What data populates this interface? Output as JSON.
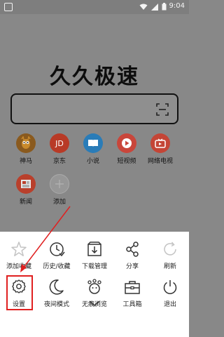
{
  "status_bar": {
    "time": "9:04"
  },
  "home": {
    "title": "久久极速",
    "shortcuts": [
      {
        "label": "神马",
        "icon": "shenma-icon",
        "color": "#a5671f"
      },
      {
        "label": "京东",
        "icon": "jd-icon",
        "color": "#ce3b24",
        "text": "JD"
      },
      {
        "label": "小说",
        "icon": "book-icon",
        "color": "#2b8dd6"
      },
      {
        "label": "短视频",
        "icon": "play-icon",
        "color": "#e8453c"
      },
      {
        "label": "网络电视",
        "icon": "tv-icon",
        "color": "#e24a3b"
      },
      {
        "label": "新闻",
        "icon": "news-icon",
        "color": "#d4452f"
      },
      {
        "label": "添加",
        "icon": "add-icon",
        "color": "#9a9a9a"
      }
    ]
  },
  "menu": {
    "items": [
      {
        "label": "添加收藏",
        "icon": "star-icon"
      },
      {
        "label": "历史/收藏",
        "icon": "history-icon"
      },
      {
        "label": "下载管理",
        "icon": "download-icon"
      },
      {
        "label": "分享",
        "icon": "share-icon"
      },
      {
        "label": "刷新",
        "icon": "refresh-icon"
      },
      {
        "label": "设置",
        "icon": "gear-icon"
      },
      {
        "label": "夜间模式",
        "icon": "moon-icon"
      },
      {
        "label": "无痕浏览",
        "icon": "incognito-icon"
      },
      {
        "label": "工具箱",
        "icon": "toolbox-icon"
      },
      {
        "label": "退出",
        "icon": "power-icon"
      }
    ]
  },
  "colors": {
    "highlight": "#e02020",
    "overlay": "#888888"
  }
}
